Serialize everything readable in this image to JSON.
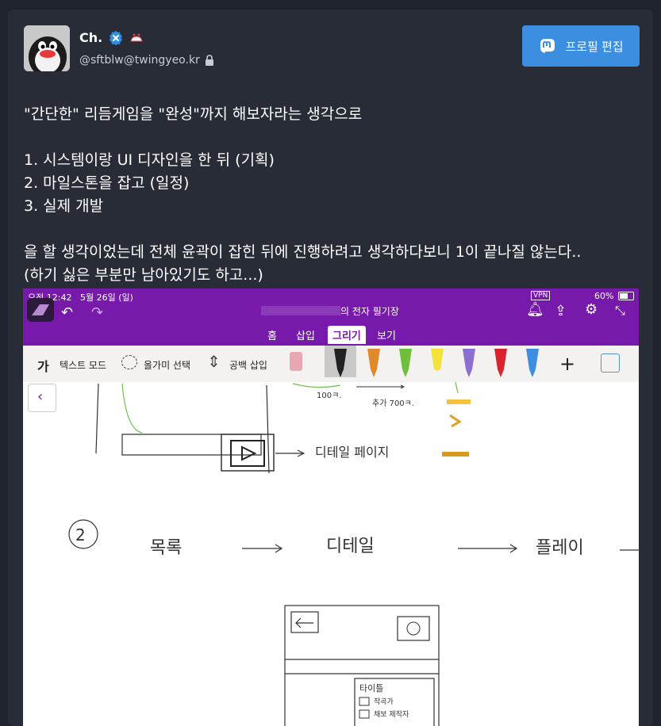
{
  "profile": {
    "display_name": "Ch.",
    "handle": "@sftblw@twingyeo.kr",
    "edit_button_label": "프로필 편집"
  },
  "post": {
    "lines": [
      "\"간단한\" 리듬게임을 \"완성\"까지 해보자라는 생각으로",
      "",
      "1. 시스템이랑 UI 디자인을 한 뒤 (기획)",
      "2. 마일스톤을 잡고 (일정)",
      "3. 실제 개발",
      "",
      "을 할 생각이었는데 전체 윤곽이 잡힌 뒤에 진행하려고 생각하다보니 1이 끝나질 않는다..",
      "(하기 싫은 부분만 남아있기도 하고...)"
    ]
  },
  "screenshot": {
    "status_time": "오전 12:42",
    "status_date": "5월 26일 (일)",
    "vpn": "VPN",
    "battery": "60%",
    "app_title": "의 전자 필기장",
    "tabs": [
      "홈",
      "삽입",
      "그리기",
      "보기"
    ],
    "active_tab": "그리기",
    "tools": {
      "text_mode": "텍스트 모드",
      "lasso": "올가미 선택",
      "space": "공백 삽입",
      "text_mode_glyph": "가"
    },
    "handwriting": {
      "label_100": "100ㅋ.",
      "label_add": "추가 700ㅋ.",
      "detail_page": "디테일 페이지",
      "circle_2": "2",
      "list": "목록",
      "detail": "디테일",
      "play": "플레이",
      "title": "타이틀",
      "composer": "작곡가",
      "charter": "채보 제작자"
    }
  },
  "colors": {
    "page_bg": "#1f232b",
    "card_bg": "#282c37",
    "accent": "#3c8fe0",
    "onenote_purple": "#7719aa"
  }
}
